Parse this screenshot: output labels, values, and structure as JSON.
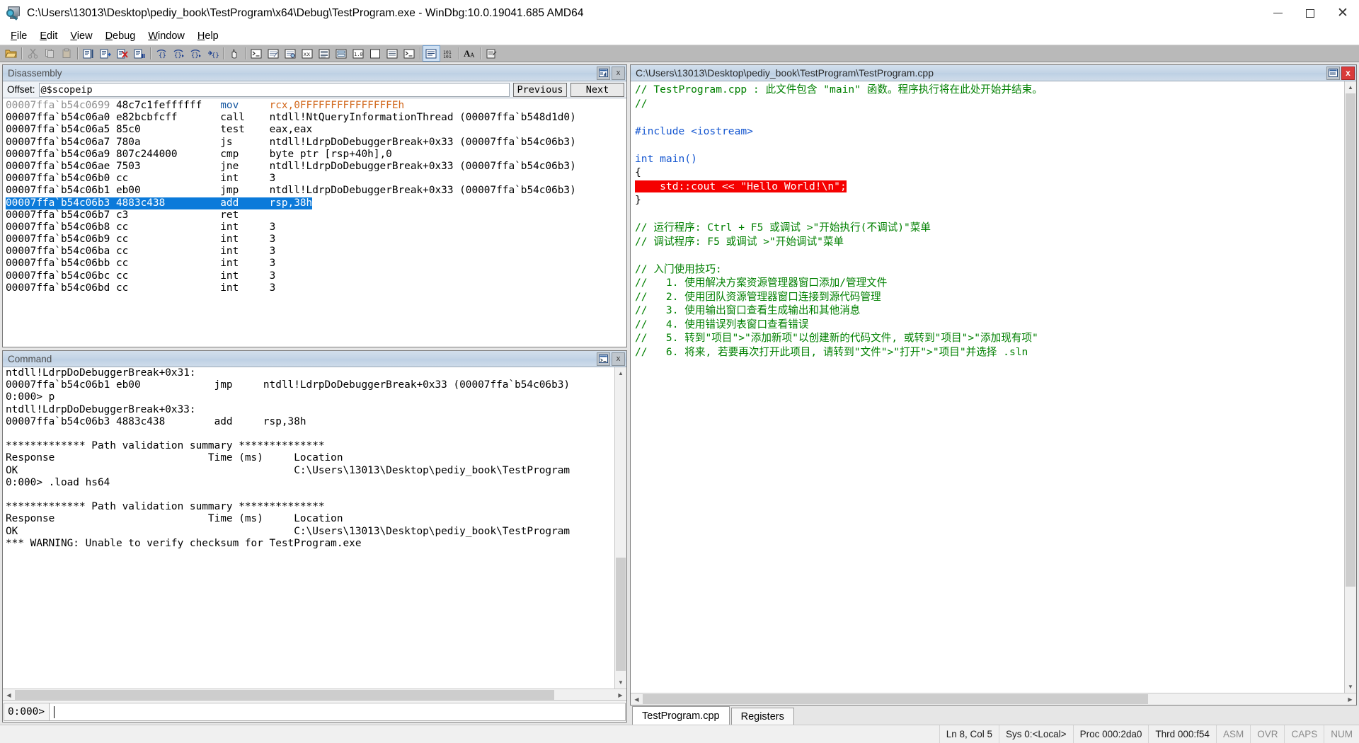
{
  "window": {
    "title": "C:\\Users\\13013\\Desktop\\pediy_book\\TestProgram\\x64\\Debug\\TestProgram.exe - WinDbg:10.0.19041.685 AMD64",
    "icon": "windbg-magnifier-icon",
    "minimize_label": "Minimize",
    "maximize_label": "Maximize",
    "close_label": "Close"
  },
  "menu": [
    {
      "label": "File",
      "accel": "F"
    },
    {
      "label": "Edit",
      "accel": "E"
    },
    {
      "label": "View",
      "accel": "V"
    },
    {
      "label": "Debug",
      "accel": "D"
    },
    {
      "label": "Window",
      "accel": "W"
    },
    {
      "label": "Help",
      "accel": "H"
    }
  ],
  "toolbar": {
    "buttons": [
      "open-executable-icon",
      "sep",
      "cut-icon",
      "copy-icon",
      "paste-icon",
      "sep",
      "go-icon",
      "go-unhandled-icon",
      "stop-debugging-icon",
      "break-icon",
      "sep",
      "step-into-icon",
      "step-over-icon",
      "step-out-icon",
      "run-to-cursor-icon",
      "sep",
      "hand-icon",
      "sep",
      "command-window-icon",
      "watch-window-icon",
      "locals-window-icon",
      "registers-window-icon",
      "memory-window-icon",
      "call-stack-window-icon",
      "disassembly-window-icon",
      "scratch-pad-icon",
      "processes-threads-icon",
      "command-browser-icon",
      "sep",
      "source-window-icon",
      "numbers-icon",
      "sep",
      "font-icon",
      "sep",
      "options-icon"
    ]
  },
  "disassembly": {
    "caption": "Disassembly",
    "caption_buttons": [
      "dock-icon",
      "close-icon"
    ],
    "offset_label": "Offset:",
    "offset_value": "@$scopeip",
    "previous_label": "Previous",
    "next_label": "Next",
    "lines": [
      {
        "addr": "00007ffa`b54c0699",
        "addr_dim": true,
        "bytes": "48c7c1feffffff",
        "mnem": "mov",
        "mnem_color": "#1456a0",
        "ops": "rcx,0FFFFFFFFFFFFFFFEh",
        "ops_color": "#d2691e",
        "highlight": false
      },
      {
        "addr": "00007ffa`b54c06a0",
        "addr_dim": false,
        "bytes": "e82bcbfcff",
        "mnem": "call",
        "mnem_color": "#000000",
        "ops": "ntdll!NtQueryInformationThread (00007ffa`b548d1d0)",
        "ops_color": "#000000",
        "highlight": false
      },
      {
        "addr": "00007ffa`b54c06a5",
        "addr_dim": false,
        "bytes": "85c0",
        "mnem": "test",
        "mnem_color": "#000000",
        "ops": "eax,eax",
        "ops_color": "#000000",
        "highlight": false
      },
      {
        "addr": "00007ffa`b54c06a7",
        "addr_dim": false,
        "bytes": "780a",
        "mnem": "js",
        "mnem_color": "#000000",
        "ops": "ntdll!LdrpDoDebuggerBreak+0x33 (00007ffa`b54c06b3)",
        "ops_color": "#000000",
        "highlight": false
      },
      {
        "addr": "00007ffa`b54c06a9",
        "addr_dim": false,
        "bytes": "807c244000",
        "mnem": "cmp",
        "mnem_color": "#000000",
        "ops": "byte ptr [rsp+40h],0",
        "ops_color": "#000000",
        "highlight": false
      },
      {
        "addr": "00007ffa`b54c06ae",
        "addr_dim": false,
        "bytes": "7503",
        "mnem": "jne",
        "mnem_color": "#000000",
        "ops": "ntdll!LdrpDoDebuggerBreak+0x33 (00007ffa`b54c06b3)",
        "ops_color": "#000000",
        "highlight": false
      },
      {
        "addr": "00007ffa`b54c06b0",
        "addr_dim": false,
        "bytes": "cc",
        "mnem": "int",
        "mnem_color": "#000000",
        "ops": "3",
        "ops_color": "#000000",
        "highlight": false
      },
      {
        "addr": "00007ffa`b54c06b1",
        "addr_dim": false,
        "bytes": "eb00",
        "mnem": "jmp",
        "mnem_color": "#000000",
        "ops": "ntdll!LdrpDoDebuggerBreak+0x33 (00007ffa`b54c06b3)",
        "ops_color": "#000000",
        "highlight": false
      },
      {
        "addr": "00007ffa`b54c06b3",
        "addr_dim": false,
        "bytes": "4883c438",
        "mnem": "add",
        "mnem_color": "#ffffff",
        "ops": "rsp,38h",
        "ops_color": "#ffffff",
        "highlight": true
      },
      {
        "addr": "00007ffa`b54c06b7",
        "addr_dim": false,
        "bytes": "c3",
        "mnem": "ret",
        "mnem_color": "#000000",
        "ops": "",
        "ops_color": "#000000",
        "highlight": false
      },
      {
        "addr": "00007ffa`b54c06b8",
        "addr_dim": false,
        "bytes": "cc",
        "mnem": "int",
        "mnem_color": "#000000",
        "ops": "3",
        "ops_color": "#000000",
        "highlight": false
      },
      {
        "addr": "00007ffa`b54c06b9",
        "addr_dim": false,
        "bytes": "cc",
        "mnem": "int",
        "mnem_color": "#000000",
        "ops": "3",
        "ops_color": "#000000",
        "highlight": false
      },
      {
        "addr": "00007ffa`b54c06ba",
        "addr_dim": false,
        "bytes": "cc",
        "mnem": "int",
        "mnem_color": "#000000",
        "ops": "3",
        "ops_color": "#000000",
        "highlight": false
      },
      {
        "addr": "00007ffa`b54c06bb",
        "addr_dim": false,
        "bytes": "cc",
        "mnem": "int",
        "mnem_color": "#000000",
        "ops": "3",
        "ops_color": "#000000",
        "highlight": false
      },
      {
        "addr": "00007ffa`b54c06bc",
        "addr_dim": false,
        "bytes": "cc",
        "mnem": "int",
        "mnem_color": "#000000",
        "ops": "3",
        "ops_color": "#000000",
        "highlight": false
      },
      {
        "addr": "00007ffa`b54c06bd",
        "addr_dim": false,
        "bytes": "cc",
        "mnem": "int",
        "mnem_color": "#000000",
        "ops": "3",
        "ops_color": "#000000",
        "highlight": false
      }
    ]
  },
  "command": {
    "caption": "Command",
    "caption_buttons": [
      "command-icon",
      "close-icon"
    ],
    "text": "ntdll!LdrpDoDebuggerBreak+0x31:\n00007ffa`b54c06b1 eb00            jmp     ntdll!LdrpDoDebuggerBreak+0x33 (00007ffa`b54c06b3)\n0:000> p\nntdll!LdrpDoDebuggerBreak+0x33:\n00007ffa`b54c06b3 4883c438        add     rsp,38h\n\n************* Path validation summary **************\nResponse                         Time (ms)     Location\nOK                                             C:\\Users\\13013\\Desktop\\pediy_book\\TestProgram\n0:000> .load hs64\n\n************* Path validation summary **************\nResponse                         Time (ms)     Location\nOK                                             C:\\Users\\13013\\Desktop\\pediy_book\\TestProgram\n*** WARNING: Unable to verify checksum for TestProgram.exe",
    "prompt": "0:000>",
    "input_value": ""
  },
  "source": {
    "caption": "C:\\Users\\13013\\Desktop\\pediy_book\\TestProgram\\TestProgram.cpp",
    "caption_buttons": [
      "dock-icon",
      "close-icon"
    ],
    "lines": [
      {
        "text": "// TestProgram.cpp : 此文件包含 \"main\" 函数。程序执行将在此处开始并结束。",
        "color": "#008000",
        "highlight": false
      },
      {
        "text": "//",
        "color": "#008000",
        "highlight": false
      },
      {
        "text": "",
        "color": "#000000",
        "highlight": false
      },
      {
        "text": "#include <iostream>",
        "color": "#1456d0",
        "highlight": false
      },
      {
        "text": "",
        "color": "#000000",
        "highlight": false
      },
      {
        "text": "int main()",
        "color": "#1456d0",
        "highlight": false
      },
      {
        "text": "{",
        "color": "#000000",
        "highlight": false
      },
      {
        "text": "    std::cout << \"Hello World!\\n\";",
        "color": "#ffffff",
        "highlight": true
      },
      {
        "text": "}",
        "color": "#000000",
        "highlight": false
      },
      {
        "text": "",
        "color": "#000000",
        "highlight": false
      },
      {
        "text": "// 运行程序: Ctrl + F5 或调试 >\"开始执行(不调试)\"菜单",
        "color": "#008000",
        "highlight": false
      },
      {
        "text": "// 调试程序: F5 或调试 >\"开始调试\"菜单",
        "color": "#008000",
        "highlight": false
      },
      {
        "text": "",
        "color": "#000000",
        "highlight": false
      },
      {
        "text": "// 入门使用技巧:",
        "color": "#008000",
        "highlight": false
      },
      {
        "text": "//   1. 使用解决方案资源管理器窗口添加/管理文件",
        "color": "#008000",
        "highlight": false
      },
      {
        "text": "//   2. 使用团队资源管理器窗口连接到源代码管理",
        "color": "#008000",
        "highlight": false
      },
      {
        "text": "//   3. 使用输出窗口查看生成输出和其他消息",
        "color": "#008000",
        "highlight": false
      },
      {
        "text": "//   4. 使用错误列表窗口查看错误",
        "color": "#008000",
        "highlight": false
      },
      {
        "text": "//   5. 转到\"项目\">\"添加新项\"以创建新的代码文件, 或转到\"项目\">\"添加现有项\"",
        "color": "#008000",
        "highlight": false
      },
      {
        "text": "//   6. 将来, 若要再次打开此项目, 请转到\"文件\">\"打开\">\"项目\"并选择 .sln",
        "color": "#008000",
        "highlight": false
      }
    ],
    "tabs": [
      {
        "label": "TestProgram.cpp",
        "active": true
      },
      {
        "label": "Registers",
        "active": false
      }
    ]
  },
  "statusbar": {
    "cells": [
      {
        "label": "Ln 8, Col 5",
        "dim": false
      },
      {
        "label": "Sys 0:<Local>",
        "dim": false
      },
      {
        "label": "Proc 000:2da0",
        "dim": false
      },
      {
        "label": "Thrd 000:f54",
        "dim": false
      },
      {
        "label": "ASM",
        "dim": true
      },
      {
        "label": "OVR",
        "dim": true
      },
      {
        "label": "CAPS",
        "dim": true
      },
      {
        "label": "NUM",
        "dim": true
      }
    ]
  },
  "colors": {
    "highlight_blue": "#0b7ada",
    "error_red": "#f50000",
    "comment_green": "#008000",
    "keyword_blue": "#1456d0",
    "register_orange": "#d2691e",
    "caption_blue": "#c3d4e6"
  }
}
